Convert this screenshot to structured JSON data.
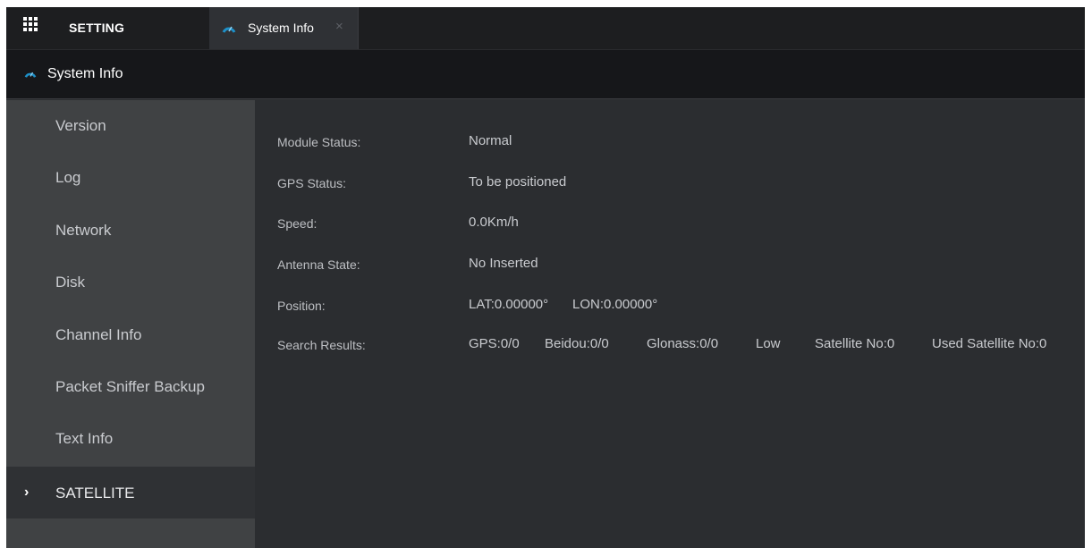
{
  "tabbar": {
    "setting_label": "SETTING",
    "active_tab": {
      "label": "System Info",
      "close": "×"
    }
  },
  "header": {
    "title": "System Info"
  },
  "sidebar": {
    "items": [
      {
        "label": "Version"
      },
      {
        "label": "Log"
      },
      {
        "label": "Network"
      },
      {
        "label": "Disk"
      },
      {
        "label": "Channel Info"
      },
      {
        "label": "Packet Sniffer Backup"
      },
      {
        "label": "Text Info"
      },
      {
        "label": "SATELLITE",
        "active": true,
        "marker": "›"
      }
    ]
  },
  "content": {
    "module_status": {
      "label": "Module Status:",
      "value": "Normal"
    },
    "gps_status": {
      "label": "GPS Status:",
      "value": "To be positioned"
    },
    "speed": {
      "label": "Speed:",
      "value": "0.0Km/h"
    },
    "antenna_state": {
      "label": "Antenna State:",
      "value": "No Inserted"
    },
    "position": {
      "label": "Position:",
      "lat": "LAT:0.00000°",
      "lon": "LON:0.00000°"
    },
    "search_results": {
      "label": "Search Results:",
      "gps": "GPS:0/0",
      "beidou": "Beidou:0/0",
      "glonass": "Glonass:0/0",
      "signal": "Low",
      "satellite_no": "Satellite No:0",
      "used_satellite_no": "Used Satellite No:0"
    }
  },
  "icons": {
    "home": "grid-icon",
    "page": "gauge-icon"
  },
  "colors": {
    "accent": "#1e90c8",
    "background": "#2b2d30",
    "sidebar": "#404244"
  }
}
